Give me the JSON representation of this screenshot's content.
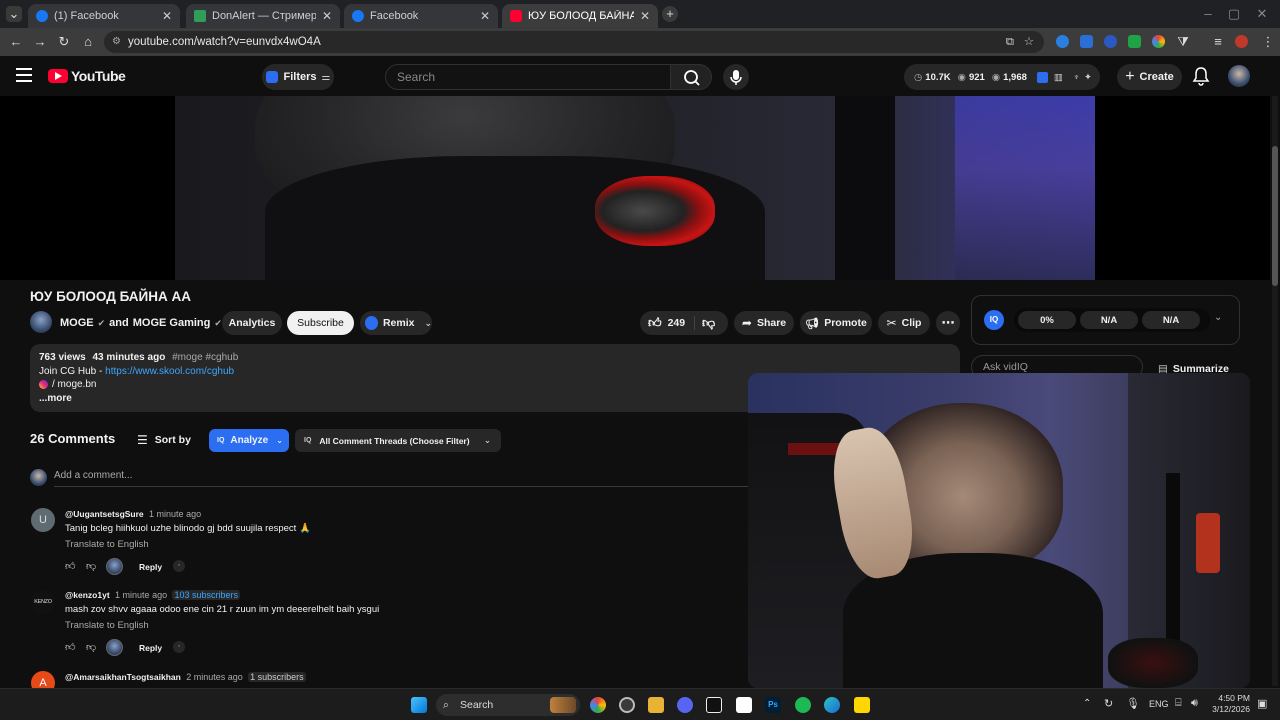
{
  "browser": {
    "tabs": [
      {
        "title": "(1) Facebook",
        "color": "#1877f2",
        "active": false
      },
      {
        "title": "DonAlert — Стримерүүдэд зор",
        "color": "#2e9e5a",
        "active": false
      },
      {
        "title": "Facebook",
        "color": "#1877f2",
        "active": false
      },
      {
        "title": "ЮУ БОЛООД БАЙНА АА - You",
        "color": "#ff0033",
        "active": true
      }
    ],
    "url": "youtube.com/watch?v=eunvdx4wO4A"
  },
  "youtube": {
    "logo_text": "YouTube",
    "filters_label": "Filters",
    "search_placeholder": "Search",
    "stats": {
      "views": "10.7K",
      "likes_stat": "921",
      "third": "1,968"
    },
    "create_label": "Create"
  },
  "video": {
    "title": "ЮУ БОЛООД БАЙНА АА",
    "channel": "MOGE",
    "channel_and": "and",
    "collab_channel": "MOGE Gaming",
    "analytics_label": "Analytics",
    "subscribe_label": "Subscribe",
    "remix_label": "Remix",
    "like_count": "249",
    "share_label": "Share",
    "promote_label": "Promote",
    "clip_label": "Clip"
  },
  "description": {
    "views": "763 views",
    "age": "43 minutes ago",
    "tags": "#moge #cghub",
    "line1_prefix": "Join CG Hub - ",
    "line1_link": "https://www.skool.com/cghub",
    "line2": "/ moge.bn",
    "more": "...more"
  },
  "sidepanel": {
    "score1": "0%",
    "score2": "N/A",
    "score3": "N/A",
    "ask_placeholder": "Ask vidIQ",
    "summarize_label": "Summarize"
  },
  "comments": {
    "count_label": "26 Comments",
    "sort_label": "Sort by",
    "analyze_label": "Analyze",
    "filter_label": "All Comment Threads (Choose Filter)",
    "add_placeholder": "Add a comment...",
    "items": [
      {
        "author": "@UugantsetsgSure",
        "time": "1 minute ago",
        "subs": "",
        "text": "Tanig bcleg hiihkuol uzhe blinodo gj bdd suujila respect 🙏",
        "translate": "Translate to English",
        "reply": "Reply",
        "avatar_letter": "U",
        "avatar_color": "#5f6b73"
      },
      {
        "author": "@kenzo1yt",
        "time": "1 minute ago",
        "subs": "103 subscribers",
        "text": "mash zov shvv agaaa odoo ene cin 21 r zuun im ym deeerelhelt baih ysgui",
        "translate": "Translate to English",
        "reply": "Reply",
        "avatar_letter": "KENZO",
        "avatar_color": "#111111"
      },
      {
        "author": "@AmarsaikhanTsogtsaikhan",
        "time": "2 minutes ago",
        "subs": "1 subscribers",
        "text": "",
        "translate": "",
        "reply": "",
        "avatar_letter": "A",
        "avatar_color": "#e64a19"
      }
    ]
  },
  "taskbar": {
    "search_placeholder": "Search",
    "lang": "ENG",
    "time": "4:50 PM",
    "date": "3/12/2026"
  },
  "colors": {
    "accent_blue": "#3ea6ff",
    "youtube_red": "#ff0033",
    "vidiq_blue": "#2b6ef2"
  }
}
